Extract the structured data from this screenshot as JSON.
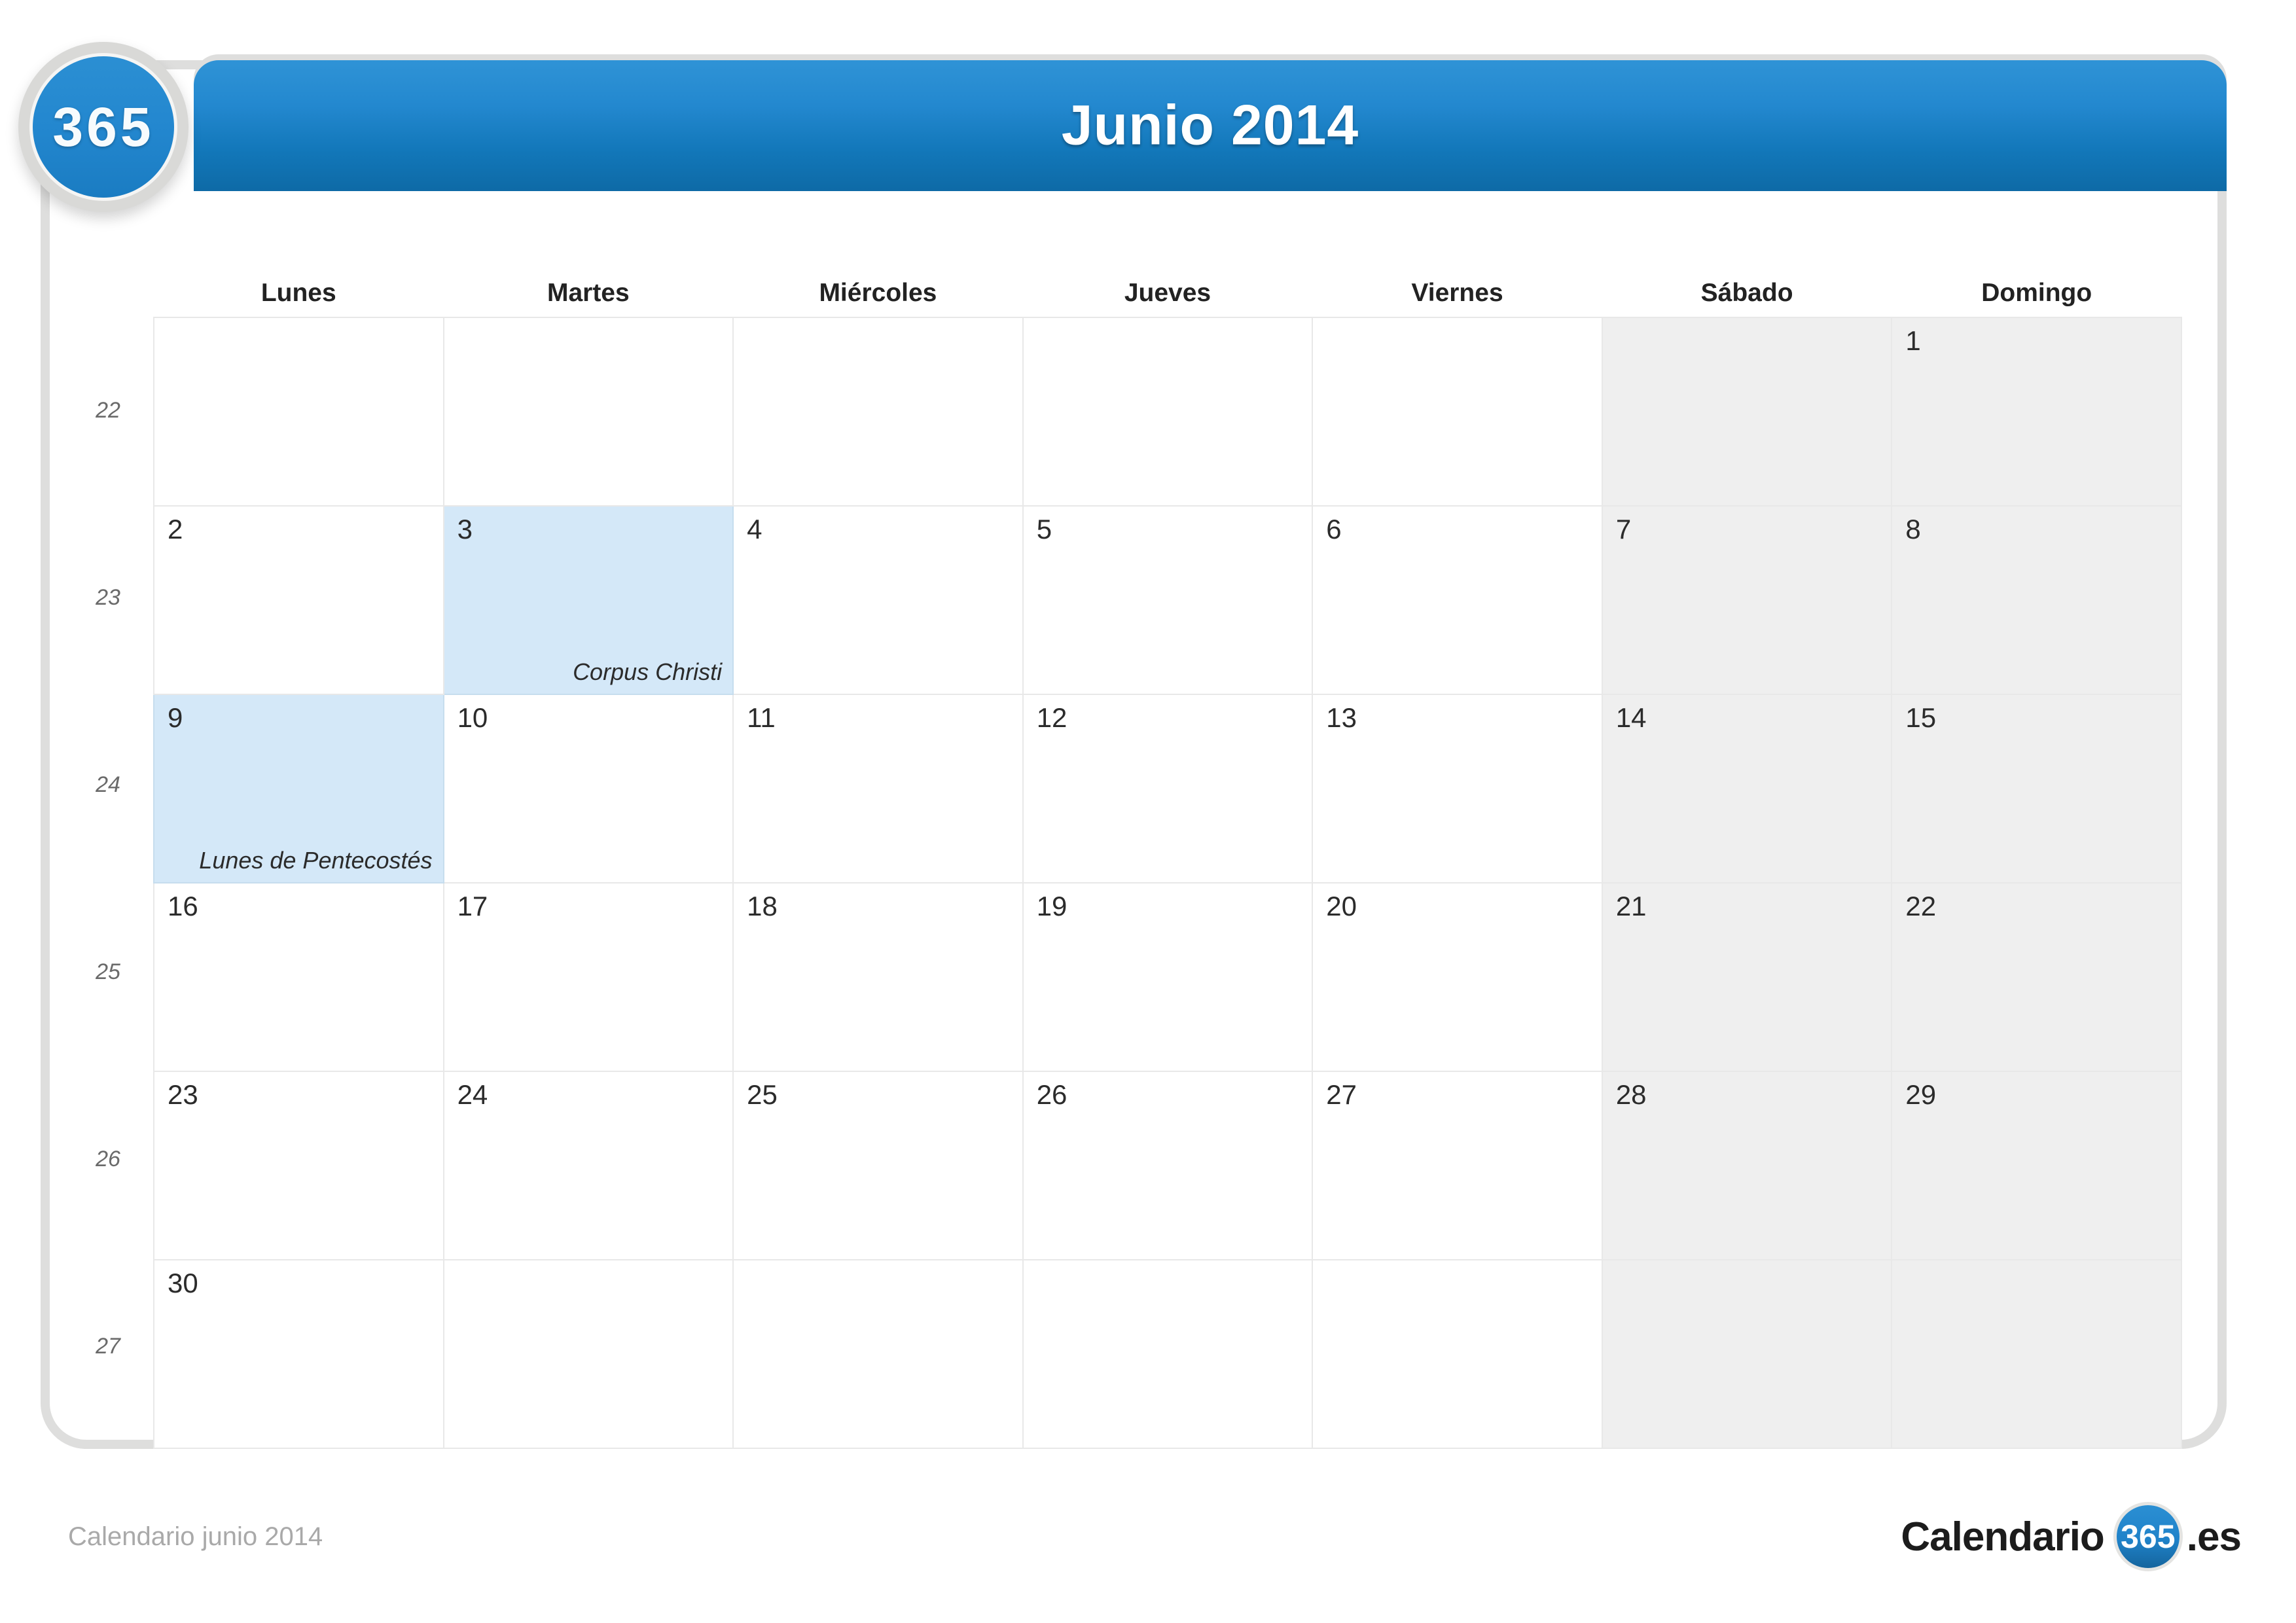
{
  "brand": {
    "badge_text": "365",
    "accent_color": "#2387cf",
    "card_border_color": "#dededd"
  },
  "header": {
    "title": "Junio 2014"
  },
  "calendar": {
    "weekday_headers": [
      "Lunes",
      "Martes",
      "Miércoles",
      "Jueves",
      "Viernes",
      "Sábado",
      "Domingo"
    ],
    "week_numbers": [
      "22",
      "23",
      "24",
      "25",
      "26",
      "27"
    ],
    "weekend_column_indices": [
      5,
      6
    ],
    "holiday_fill_color": "#d4e8f8",
    "weekend_fill_color": "#efefef",
    "weeks": [
      {
        "week_number": "22",
        "days": [
          {
            "day": "",
            "holiday": "",
            "weekend": false
          },
          {
            "day": "",
            "holiday": "",
            "weekend": false
          },
          {
            "day": "",
            "holiday": "",
            "weekend": false
          },
          {
            "day": "",
            "holiday": "",
            "weekend": false
          },
          {
            "day": "",
            "holiday": "",
            "weekend": false
          },
          {
            "day": "",
            "holiday": "",
            "weekend": true
          },
          {
            "day": "1",
            "holiday": "",
            "weekend": true
          }
        ]
      },
      {
        "week_number": "23",
        "days": [
          {
            "day": "2",
            "holiday": "",
            "weekend": false
          },
          {
            "day": "3",
            "holiday": "Corpus Christi",
            "weekend": false
          },
          {
            "day": "4",
            "holiday": "",
            "weekend": false
          },
          {
            "day": "5",
            "holiday": "",
            "weekend": false
          },
          {
            "day": "6",
            "holiday": "",
            "weekend": false
          },
          {
            "day": "7",
            "holiday": "",
            "weekend": true
          },
          {
            "day": "8",
            "holiday": "",
            "weekend": true
          }
        ]
      },
      {
        "week_number": "24",
        "days": [
          {
            "day": "9",
            "holiday": "Lunes de Pentecostés",
            "weekend": false
          },
          {
            "day": "10",
            "holiday": "",
            "weekend": false
          },
          {
            "day": "11",
            "holiday": "",
            "weekend": false
          },
          {
            "day": "12",
            "holiday": "",
            "weekend": false
          },
          {
            "day": "13",
            "holiday": "",
            "weekend": false
          },
          {
            "day": "14",
            "holiday": "",
            "weekend": true
          },
          {
            "day": "15",
            "holiday": "",
            "weekend": true
          }
        ]
      },
      {
        "week_number": "25",
        "days": [
          {
            "day": "16",
            "holiday": "",
            "weekend": false
          },
          {
            "day": "17",
            "holiday": "",
            "weekend": false
          },
          {
            "day": "18",
            "holiday": "",
            "weekend": false
          },
          {
            "day": "19",
            "holiday": "",
            "weekend": false
          },
          {
            "day": "20",
            "holiday": "",
            "weekend": false
          },
          {
            "day": "21",
            "holiday": "",
            "weekend": true
          },
          {
            "day": "22",
            "holiday": "",
            "weekend": true
          }
        ]
      },
      {
        "week_number": "26",
        "days": [
          {
            "day": "23",
            "holiday": "",
            "weekend": false
          },
          {
            "day": "24",
            "holiday": "",
            "weekend": false
          },
          {
            "day": "25",
            "holiday": "",
            "weekend": false
          },
          {
            "day": "26",
            "holiday": "",
            "weekend": false
          },
          {
            "day": "27",
            "holiday": "",
            "weekend": false
          },
          {
            "day": "28",
            "holiday": "",
            "weekend": true
          },
          {
            "day": "29",
            "holiday": "",
            "weekend": true
          }
        ]
      },
      {
        "week_number": "27",
        "days": [
          {
            "day": "30",
            "holiday": "",
            "weekend": false
          },
          {
            "day": "",
            "holiday": "",
            "weekend": false
          },
          {
            "day": "",
            "holiday": "",
            "weekend": false
          },
          {
            "day": "",
            "holiday": "",
            "weekend": false
          },
          {
            "day": "",
            "holiday": "",
            "weekend": false
          },
          {
            "day": "",
            "holiday": "",
            "weekend": true
          },
          {
            "day": "",
            "holiday": "",
            "weekend": true
          }
        ]
      }
    ]
  },
  "watermark": {
    "text": "365"
  },
  "footer": {
    "caption": "Calendario junio 2014",
    "logo_word": "Calendario",
    "logo_circle": "365",
    "logo_tld": ".es"
  }
}
